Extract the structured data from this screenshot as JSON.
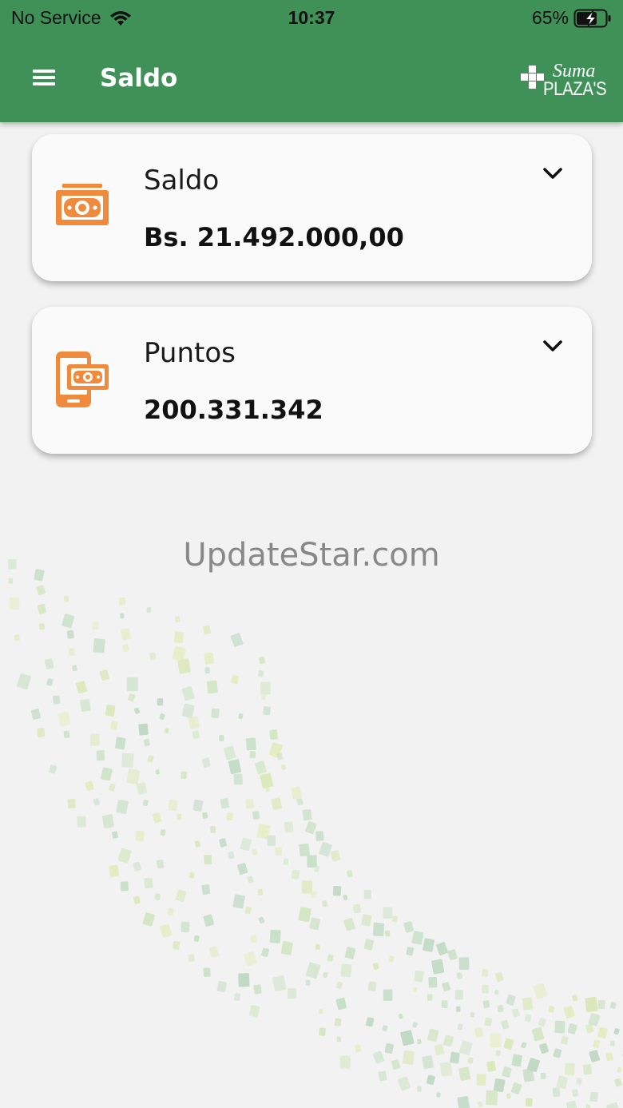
{
  "status_bar": {
    "carrier": "No Service",
    "time": "10:37",
    "battery": "65%"
  },
  "header": {
    "title": "Saldo",
    "logo_top": "Suma",
    "logo_bottom": "PLAZA'S",
    "background_color": "#3f9158"
  },
  "cards": [
    {
      "title": "Saldo",
      "value": "Bs. 21.492.000,00",
      "icon": "cash-icon"
    },
    {
      "title": "Puntos",
      "value": "200.331.342",
      "icon": "mobile-payment-icon"
    }
  ],
  "watermark": "UpdateStar.com",
  "colors": {
    "accent": "#f08a3c",
    "header_green": "#3f9158"
  }
}
